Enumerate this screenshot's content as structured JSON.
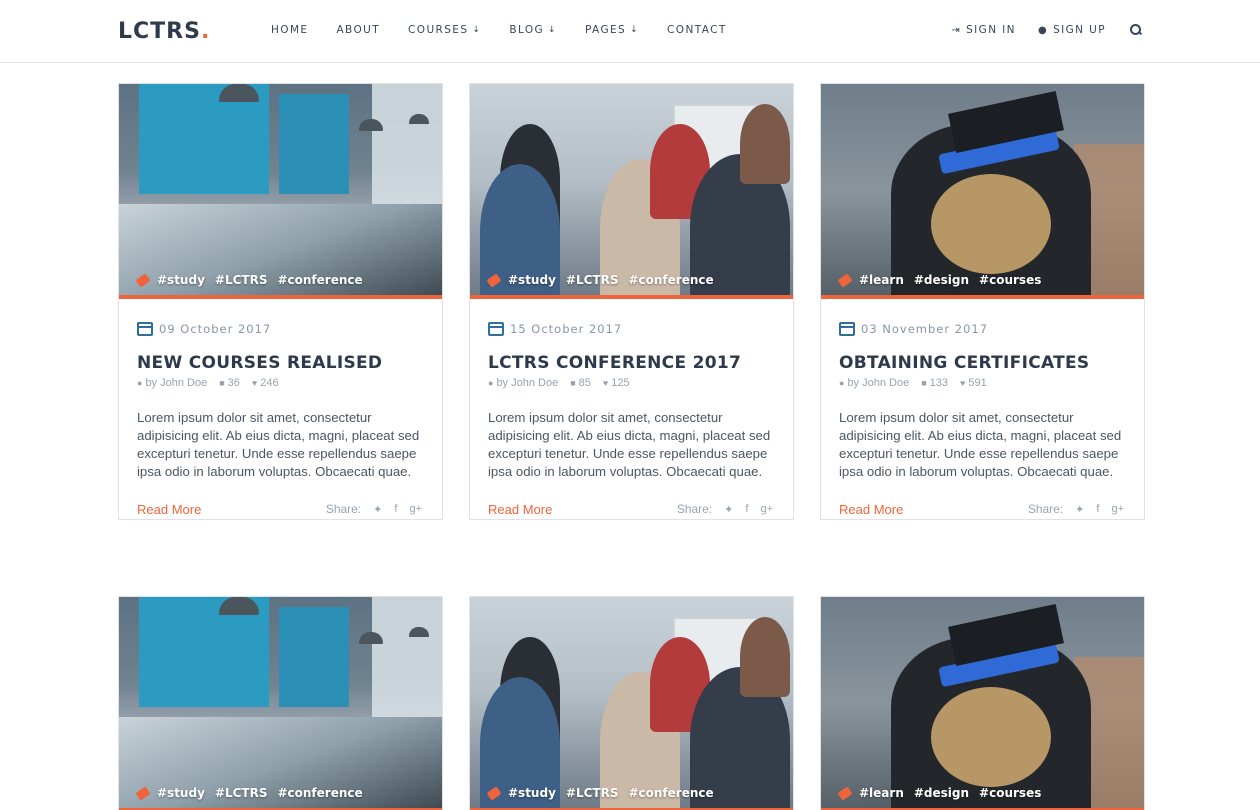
{
  "brand": {
    "name": "LCTRS",
    "dot": ".",
    "accent_color": "#f0643c"
  },
  "nav": {
    "items": [
      {
        "label": "HOME",
        "has_caret": false
      },
      {
        "label": "ABOUT",
        "has_caret": false
      },
      {
        "label": "COURSES",
        "has_caret": true
      },
      {
        "label": "BLOG",
        "has_caret": true
      },
      {
        "label": "PAGES",
        "has_caret": true
      },
      {
        "label": "CONTACT",
        "has_caret": false
      }
    ],
    "caret": "↓"
  },
  "auth": {
    "sign_in": "SIGN IN",
    "sign_up": "SIGN UP",
    "sign_in_icon": "sign-in-icon",
    "sign_up_icon": "user-icon",
    "search_icon": "search-icon"
  },
  "posts": [
    {
      "photo": "office",
      "tags": [
        "#study",
        "#LCTRS",
        "#conference"
      ],
      "date": "09 October 2017",
      "title": "NEW COURSES REALISED",
      "author": "by John Doe",
      "comments": "36",
      "likes": "246",
      "excerpt": "Lorem ipsum dolor sit amet, consectetur adipisicing elit. Ab eius dicta, magni, placeat sed excepturi tenetur. Unde esse repellendus saepe ipsa odio in laborum voluptas. Obcaecati quae.",
      "read_more": "Read More",
      "share_label": "Share:"
    },
    {
      "photo": "meeting",
      "tags": [
        "#study",
        "#LCTRS",
        "#conference"
      ],
      "date": "15 October 2017",
      "title": "LCTRS CONFERENCE 2017",
      "author": "by John Doe",
      "comments": "85",
      "likes": "125",
      "excerpt": "Lorem ipsum dolor sit amet, consectetur adipisicing elit. Ab eius dicta, magni, placeat sed excepturi tenetur. Unde esse repellendus saepe ipsa odio in laborum voluptas. Obcaecati quae.",
      "read_more": "Read More",
      "share_label": "Share:"
    },
    {
      "photo": "grad",
      "tags": [
        "#learn",
        "#design",
        "#courses"
      ],
      "date": "03 November 2017",
      "title": "OBTAINING CERTIFICATES",
      "author": "by John Doe",
      "comments": "133",
      "likes": "591",
      "excerpt": "Lorem ipsum dolor sit amet, consectetur adipisicing elit. Ab eius dicta, magni, placeat sed excepturi tenetur. Unde esse repellendus saepe ipsa odio in laborum voluptas. Obcaecati quae.",
      "read_more": "Read More",
      "share_label": "Share:"
    },
    {
      "photo": "office",
      "tags": [
        "#study",
        "#LCTRS",
        "#conference"
      ]
    },
    {
      "photo": "meeting",
      "tags": [
        "#study",
        "#LCTRS",
        "#conference"
      ]
    },
    {
      "photo": "grad",
      "tags": [
        "#learn",
        "#design",
        "#courses"
      ]
    }
  ],
  "icons": {
    "calendar": "calendar-icon",
    "author": "user-icon",
    "comments": "comment-icon",
    "likes": "heart-icon",
    "tag": "tag-icon",
    "share": [
      "twitter-icon",
      "facebook-icon",
      "google-plus-icon"
    ]
  }
}
